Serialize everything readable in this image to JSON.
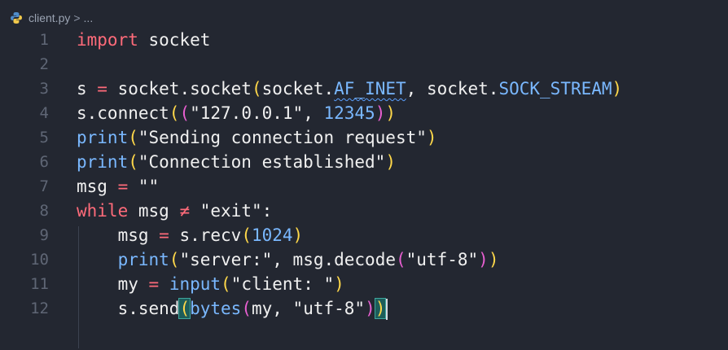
{
  "breadcrumb": {
    "file": "client.py",
    "sep": ">",
    "more": "..."
  },
  "lines": [
    {
      "n": "1"
    },
    {
      "n": "2"
    },
    {
      "n": "3"
    },
    {
      "n": "4"
    },
    {
      "n": "5"
    },
    {
      "n": "6"
    },
    {
      "n": "7"
    },
    {
      "n": "8"
    },
    {
      "n": "9"
    },
    {
      "n": "10"
    },
    {
      "n": "11"
    },
    {
      "n": "12"
    }
  ],
  "tokens": {
    "import": "import",
    "socket": "socket",
    "s": "s",
    "eq": " = ",
    "socket_socket": "socket.socket",
    "socket_dot": "socket.",
    "af_inet": "AF_INET",
    "comma": ", ",
    "sock_stream": "SOCK_STREAM",
    "s_connect": "s.connect",
    "host": "\"127.0.0.1\"",
    "port": "12345",
    "print": "print",
    "msg1": "\"Sending connection request\"",
    "msg2": "\"Connection established\"",
    "msg": "msg",
    "empty": "\"\"",
    "while": "while",
    "neq": " ≠ ",
    "exit": "\"exit\"",
    "colon": ":",
    "s_recv": "s.recv",
    "n1024": "1024",
    "server": "\"server:\"",
    "msg_decode": "msg.decode",
    "utf8": "\"utf-8\"",
    "my": "my",
    "input": "input",
    "client": "\"client: \"",
    "s_send": "s.send",
    "bytes": "bytes",
    "my_comma": "my, "
  },
  "colors": {
    "background": "#232731",
    "keyword": "#ff6b7a",
    "function": "#7ab8ff",
    "paren1": "#ffd84a",
    "paren2": "#e85fd1",
    "paren3": "#58a6ff"
  }
}
